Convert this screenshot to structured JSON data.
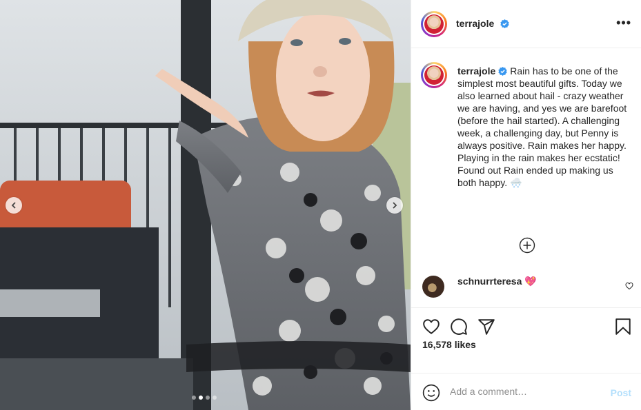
{
  "post": {
    "author": "terrajole",
    "verified": true,
    "caption": "Rain has to be one of the simplest most beautiful gifts. Today we also learned about hail - crazy weather we are having, and yes we are barefoot (before the hail started). A challenging week, a challenging day, but Penny is always positive. Rain makes her happy. Playing in the rain makes her ecstatic! Found out Rain ended up making us both happy. 🌨️",
    "likes_text": "16,578 likes",
    "carousel": {
      "count": 4,
      "active_index": 1
    }
  },
  "comments": [
    {
      "user": "schnurrteresa",
      "text": "💖"
    }
  ],
  "comment_box": {
    "placeholder": "Add a comment…",
    "post_label": "Post"
  },
  "icons": {
    "verified": "verified-badge-icon",
    "more": "more-options-icon",
    "like": "heart-icon",
    "comment": "comment-icon",
    "share": "paper-plane-icon",
    "save": "bookmark-icon",
    "emoji": "emoji-icon",
    "add": "plus-circle-icon",
    "prev": "chevron-left-icon",
    "next": "chevron-right-icon"
  },
  "colors": {
    "verified_blue": "#3897f0",
    "post_button_disabled": "#b2dffc",
    "text": "#262626",
    "muted": "#8e8e8e",
    "border": "#efefef"
  }
}
